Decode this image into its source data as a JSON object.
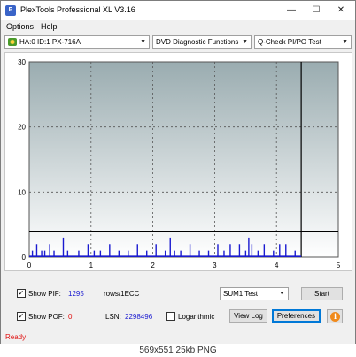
{
  "window": {
    "title": "PlexTools Professional XL V3.16",
    "icon": "plextools-app-icon",
    "controls": {
      "minimize": "—",
      "maximize": "☐",
      "close": "✕"
    }
  },
  "menu": {
    "options": "Options",
    "help": "Help"
  },
  "toolbar": {
    "drive": "HA:0 ID:1  PX-716A",
    "function": "DVD Diagnostic Functions",
    "test": "Q-Check PI/PO Test"
  },
  "chart_data": {
    "type": "bar",
    "x_ticks": [
      "0",
      "1",
      "2",
      "3",
      "4",
      "5"
    ],
    "y_ticks": [
      "0",
      "10",
      "20",
      "30"
    ],
    "xlim": [
      0,
      5
    ],
    "ylim": [
      0,
      30
    ],
    "grid": true,
    "threshold_line": 4,
    "marker_x": 4.4,
    "scan_end_x": 4.4,
    "series": [
      {
        "color": "#1a1ad0",
        "x": [
          0.05,
          0.12,
          0.2,
          0.25,
          0.33,
          0.4,
          0.55,
          0.62,
          0.8,
          0.95,
          1.05,
          1.15,
          1.3,
          1.45,
          1.6,
          1.75,
          1.9,
          2.05,
          2.2,
          2.28,
          2.35,
          2.45,
          2.6,
          2.75,
          2.9,
          3.05,
          3.15,
          3.25,
          3.4,
          3.5,
          3.55,
          3.6,
          3.7,
          3.8,
          3.95,
          4.05,
          4.15,
          4.3
        ],
        "values": [
          1,
          2,
          1,
          1,
          2,
          1,
          3,
          1,
          1,
          2,
          1,
          1,
          2,
          1,
          1,
          2,
          1,
          2,
          1,
          3,
          1,
          1,
          2,
          1,
          1,
          2,
          1,
          2,
          2,
          1,
          3,
          2,
          1,
          2,
          1,
          2,
          2,
          1
        ]
      }
    ]
  },
  "controls": {
    "show_pif_label": "Show PIF:",
    "pif_value": "1295",
    "pif_unit": "rows/1ECC",
    "show_pof_label": "Show POF:",
    "pof_value": "0",
    "lsn_label": "LSN:",
    "lsn_value": "2298496",
    "log_label": "Logarithmic",
    "sum_test": "SUM1 Test",
    "start": "Start",
    "view_log": "View Log",
    "preferences": "Preferences",
    "check": "✓"
  },
  "status": {
    "text": "Ready",
    "color": "#e01010"
  },
  "caption": "569x551  25kb  PNG"
}
